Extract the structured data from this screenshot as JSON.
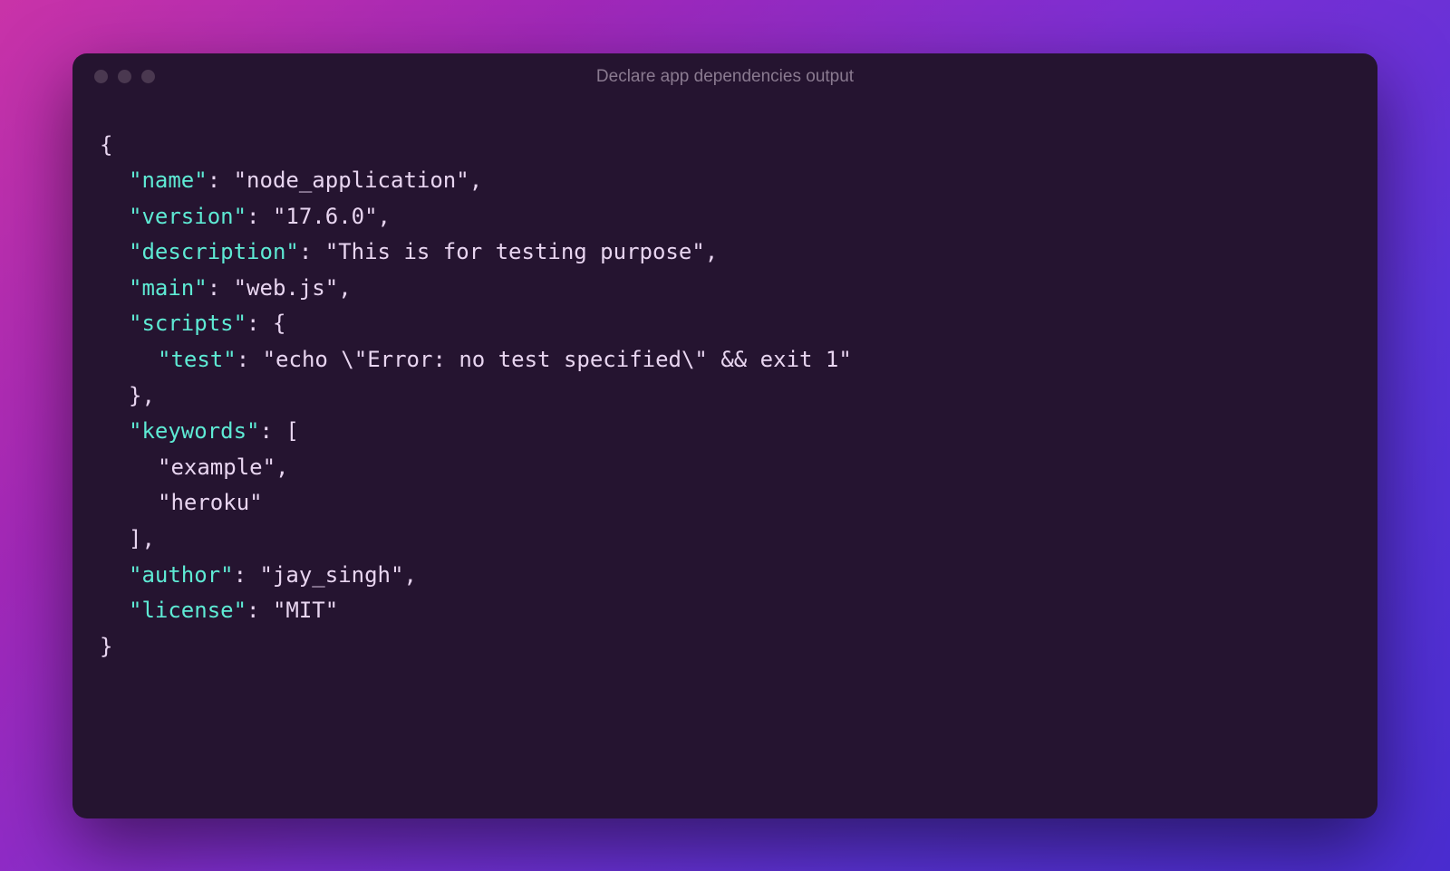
{
  "window": {
    "title": "Declare app dependencies output"
  },
  "json": {
    "keys": {
      "name": "\"name\"",
      "version": "\"version\"",
      "description": "\"description\"",
      "main": "\"main\"",
      "scripts": "\"scripts\"",
      "test": "\"test\"",
      "keywords": "\"keywords\"",
      "author": "\"author\"",
      "license": "\"license\""
    },
    "values": {
      "name": "\"node_application\"",
      "version": "\"17.6.0\"",
      "description": "\"This is for testing purpose\"",
      "main": "\"web.js\"",
      "test": "\"echo \\\"Error: no test specified\\\" && exit 1\"",
      "keyword1": "\"example\"",
      "keyword2": "\"heroku\"",
      "author": "\"jay_singh\"",
      "license": "\"MIT\""
    },
    "punct": {
      "open_brace": "{",
      "close_brace": "}",
      "open_bracket": "[",
      "close_bracket": "]",
      "colon_space": ": ",
      "comma": ",",
      "close_brace_comma": "},",
      "close_bracket_comma": "],"
    }
  }
}
